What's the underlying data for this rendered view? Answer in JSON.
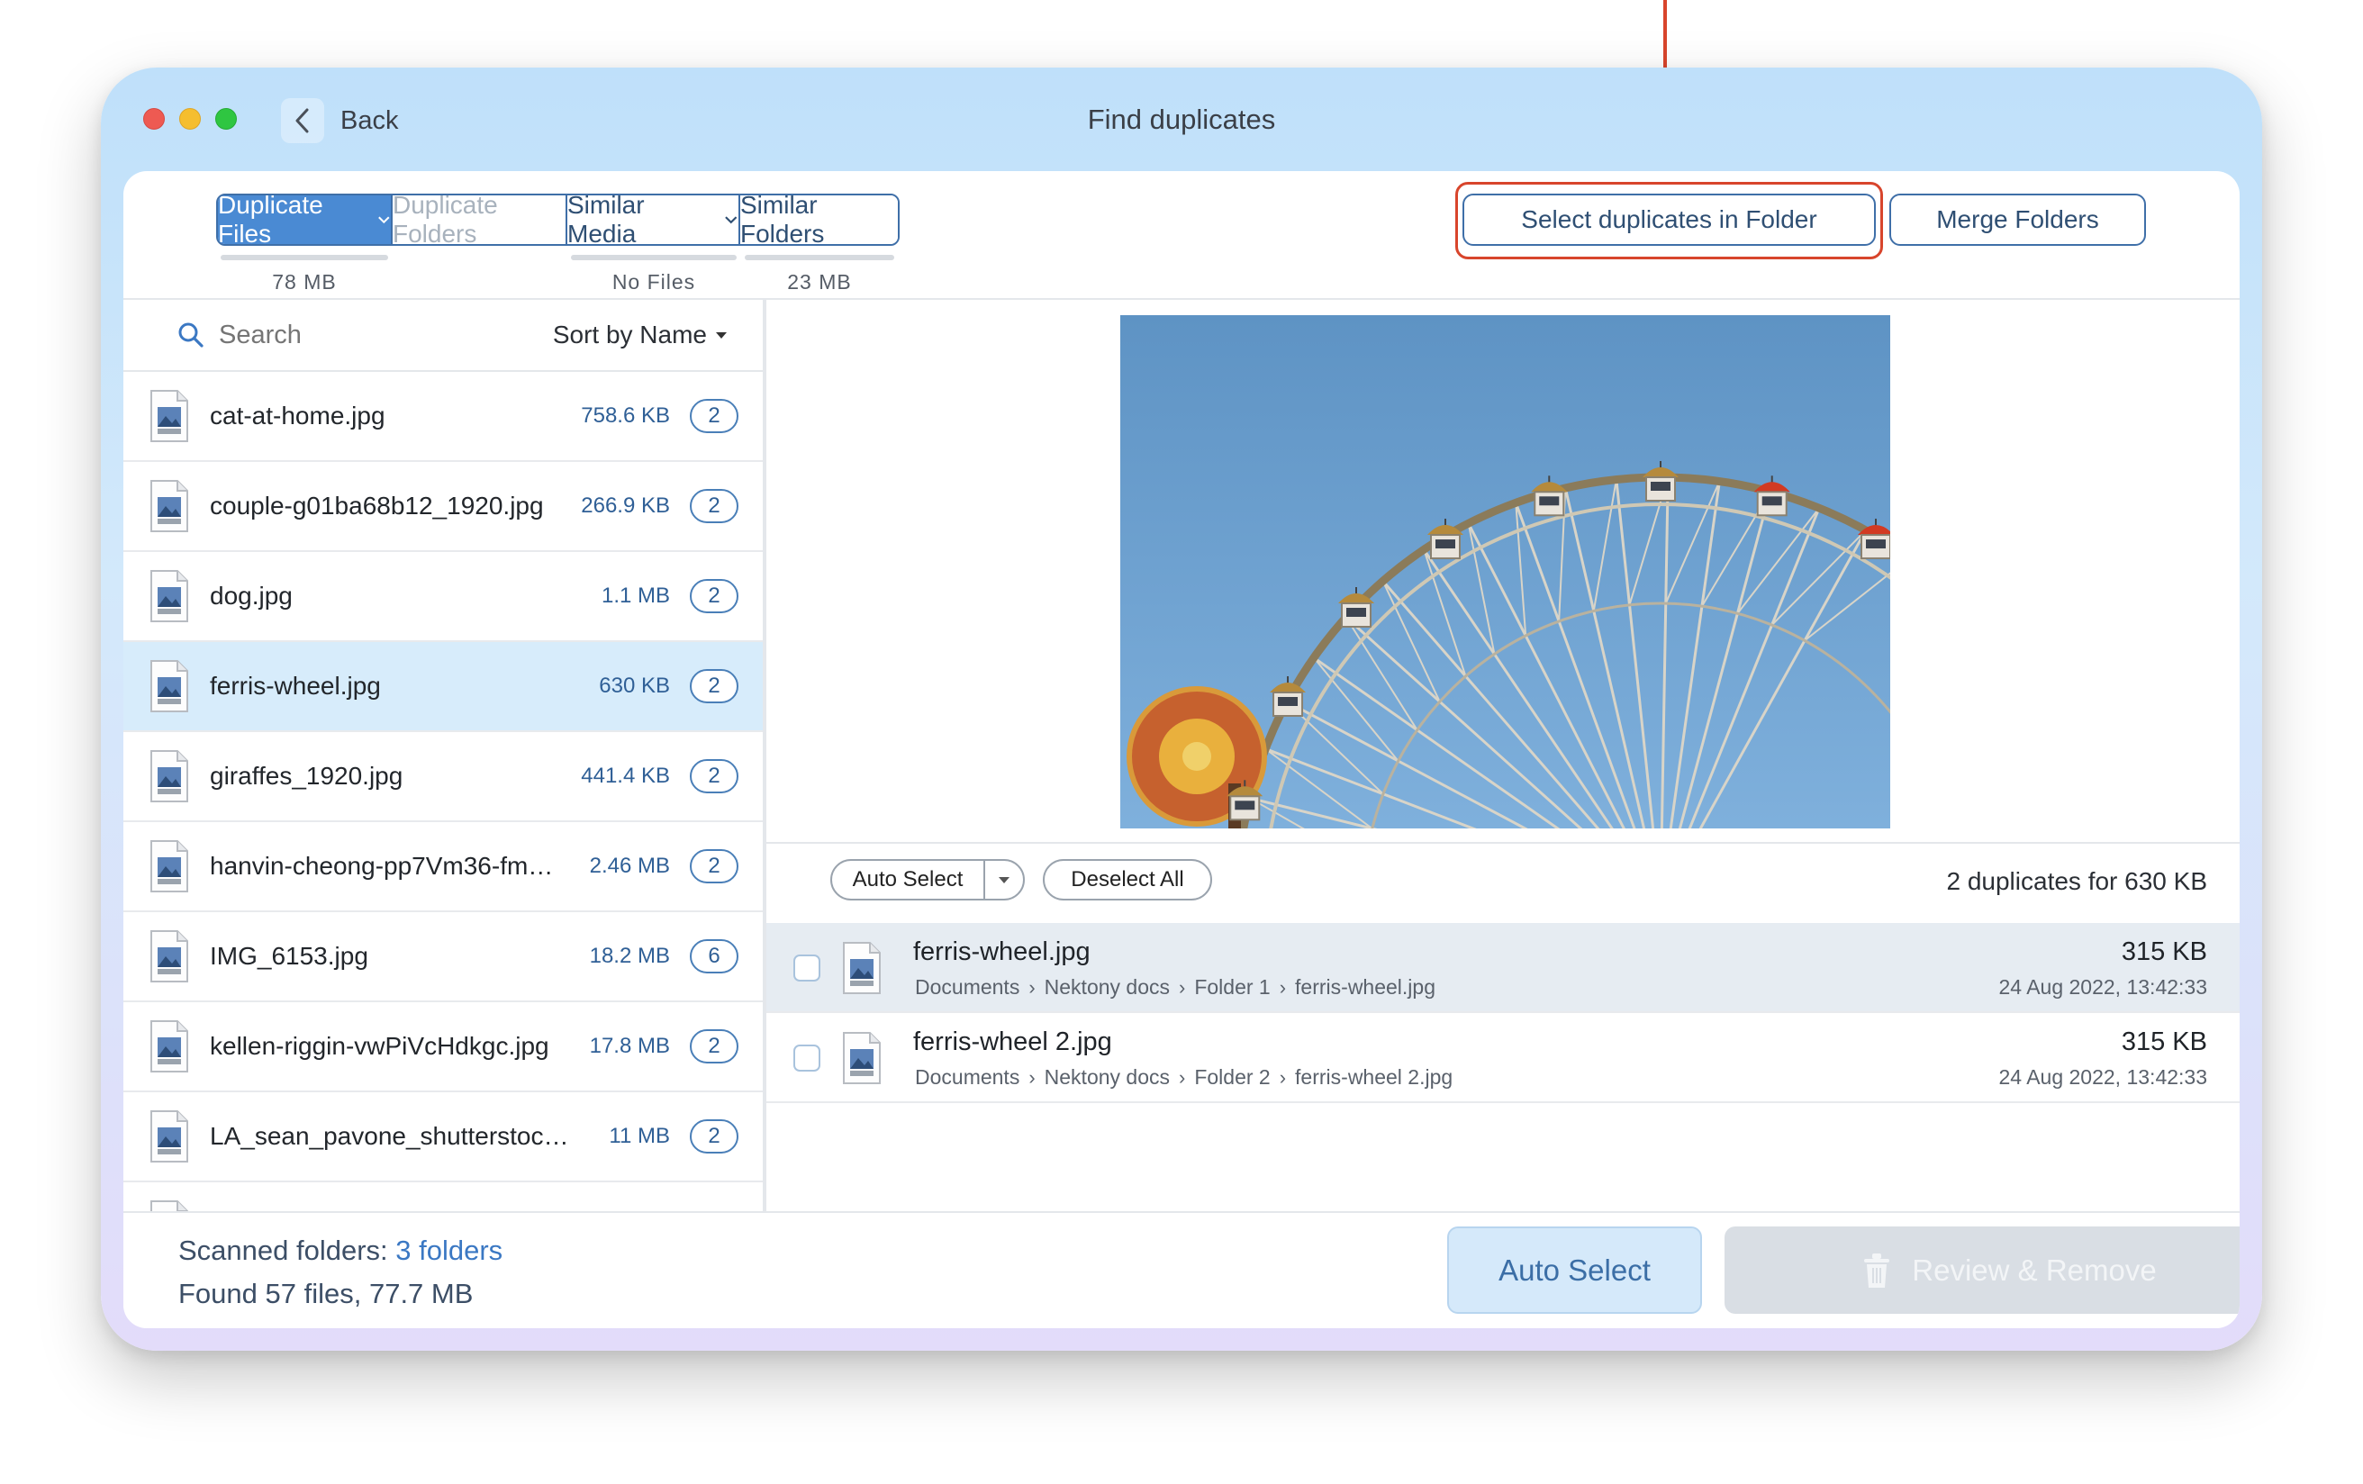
{
  "window": {
    "title": "Find duplicates",
    "back_label": "Back"
  },
  "tabs": [
    {
      "label": "Duplicate Files",
      "usage": "78 MB",
      "state": "active",
      "has_chevron": true
    },
    {
      "label": "Duplicate Folders",
      "usage": "",
      "state": "disabled",
      "has_chevron": false
    },
    {
      "label": "Similar Media",
      "usage": "No Files",
      "state": "normal",
      "has_chevron": true
    },
    {
      "label": "Similar Folders",
      "usage": "23 MB",
      "state": "normal",
      "has_chevron": false
    }
  ],
  "actions": {
    "select_in_folder": "Select duplicates in Folder",
    "merge_folders": "Merge Folders"
  },
  "file_list": {
    "search_placeholder": "Search",
    "sort_label": "Sort by Name",
    "items": [
      {
        "name": "cat-at-home.jpg",
        "size": "758.6 KB",
        "count": "2",
        "selected": false
      },
      {
        "name": "couple-g01ba68b12_1920.jpg",
        "size": "266.9 KB",
        "count": "2",
        "selected": false
      },
      {
        "name": "dog.jpg",
        "size": "1.1 MB",
        "count": "2",
        "selected": false
      },
      {
        "name": "ferris-wheel.jpg",
        "size": "630 KB",
        "count": "2",
        "selected": true
      },
      {
        "name": "giraffes_1920.jpg",
        "size": "441.4 KB",
        "count": "2",
        "selected": false
      },
      {
        "name": "hanvin-cheong-pp7Vm36-fm…",
        "size": "2.46 MB",
        "count": "2",
        "selected": false
      },
      {
        "name": "IMG_6153.jpg",
        "size": "18.2 MB",
        "count": "6",
        "selected": false
      },
      {
        "name": "kellen-riggin-vwPiVcHdkgc.jpg",
        "size": "17.8 MB",
        "count": "2",
        "selected": false
      },
      {
        "name": "LA_sean_pavone_shutterstock.…",
        "size": "11 MB",
        "count": "2",
        "selected": false
      }
    ]
  },
  "duplicates": {
    "auto_select_label": "Auto Select",
    "deselect_all_label": "Deselect All",
    "summary": "2 duplicates for 630 KB",
    "items": [
      {
        "name": "ferris-wheel.jpg",
        "path": [
          "Documents",
          "Nektony docs",
          "Folder 1",
          "ferris-wheel.jpg"
        ],
        "size": "315 KB",
        "date": "24 Aug 2022, 13:42:33",
        "highlighted": true
      },
      {
        "name": "ferris-wheel 2.jpg",
        "path": [
          "Documents",
          "Nektony docs",
          "Folder 2",
          "ferris-wheel 2.jpg"
        ],
        "size": "315 KB",
        "date": "24 Aug 2022, 13:42:33",
        "highlighted": false
      }
    ]
  },
  "footer": {
    "scanned_label": "Scanned folders:",
    "scanned_link": "3 folders",
    "found_text": "Found 57 files, 77.7 MB",
    "auto_select_button": "Auto Select",
    "review_button": "Review & Remove"
  },
  "colors": {
    "accent": "#4a8ad3",
    "annotation": "#d8452c",
    "selected_row": "#d7ecfb"
  },
  "icons": [
    "search-icon",
    "chevron-left-icon",
    "chevron-down-icon",
    "jpg-file-icon",
    "trash-icon"
  ]
}
